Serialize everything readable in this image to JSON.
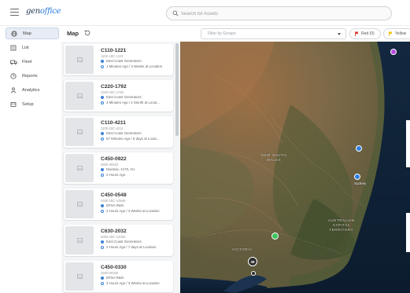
{
  "app": {
    "logo_prefix": "gen",
    "logo_suffix": "office"
  },
  "search": {
    "placeholder": "Search for Assets"
  },
  "sidebar": {
    "items": [
      {
        "label": "Map",
        "icon": "globe-icon",
        "active": true
      },
      {
        "label": "List",
        "icon": "list-icon",
        "active": false
      },
      {
        "label": "Fleet",
        "icon": "truck-icon",
        "active": false
      },
      {
        "label": "Reports",
        "icon": "clock-icon",
        "active": false
      },
      {
        "label": "Analytics",
        "icon": "analytics-icon",
        "active": false
      },
      {
        "label": "Setup",
        "icon": "setup-icon",
        "active": false
      }
    ]
  },
  "main": {
    "title": "Map",
    "group_filter_placeholder": "Filter by Groups",
    "chips": {
      "red": "Red (0)",
      "yellow": "Yellow"
    }
  },
  "assets": [
    {
      "name": "C110-1221",
      "serial": "1102-18C-1221",
      "location": "East Coast Generators",
      "time": "1 Minutes Ago / 3 Weeks at Location"
    },
    {
      "name": "C220-1792",
      "serial": "2200-18C-1792",
      "location": "East Coast Generators",
      "time": "4 Minutes Ago / 1 Month at Locat..."
    },
    {
      "name": "C110-4211",
      "serial": "1100-20C-4211",
      "location": "East Coast Generators",
      "time": "57 Minutes Ago / 5 days at Locat..."
    },
    {
      "name": "C450-0922",
      "serial": "4500-00922",
      "location": "Muranie, 4170, AU",
      "time": "2 Hours Ago"
    },
    {
      "name": "C450-0548",
      "serial": "4500-18C-10548",
      "location": "EPSA R&N",
      "time": "2 Hours Ago / 3 Weeks at Location"
    },
    {
      "name": "C630-2032",
      "serial": "6300-18C-12032",
      "location": "East Coast Generators",
      "time": "2 Hours Ago / 7 days at Location"
    },
    {
      "name": "C450-0330",
      "serial": "4500-00330",
      "location": "EPSA R&N",
      "time": "3 Hours Ago / 3 Weeks at Location"
    }
  ],
  "map": {
    "region_label_1": "NEW SOUTH",
    "region_label_2": "WALES",
    "act_label_1": "AUSTRALIAN",
    "act_label_2": "CAPITAL",
    "act_label_3": "TERRITORY",
    "victoria_label": "VICTORIA",
    "city_sydney": "Sydney",
    "cluster_count": "38",
    "colors": {
      "blue_marker": "#2f7de1",
      "green_marker": "#3cc45a",
      "purple_marker": "#b548e0"
    }
  }
}
